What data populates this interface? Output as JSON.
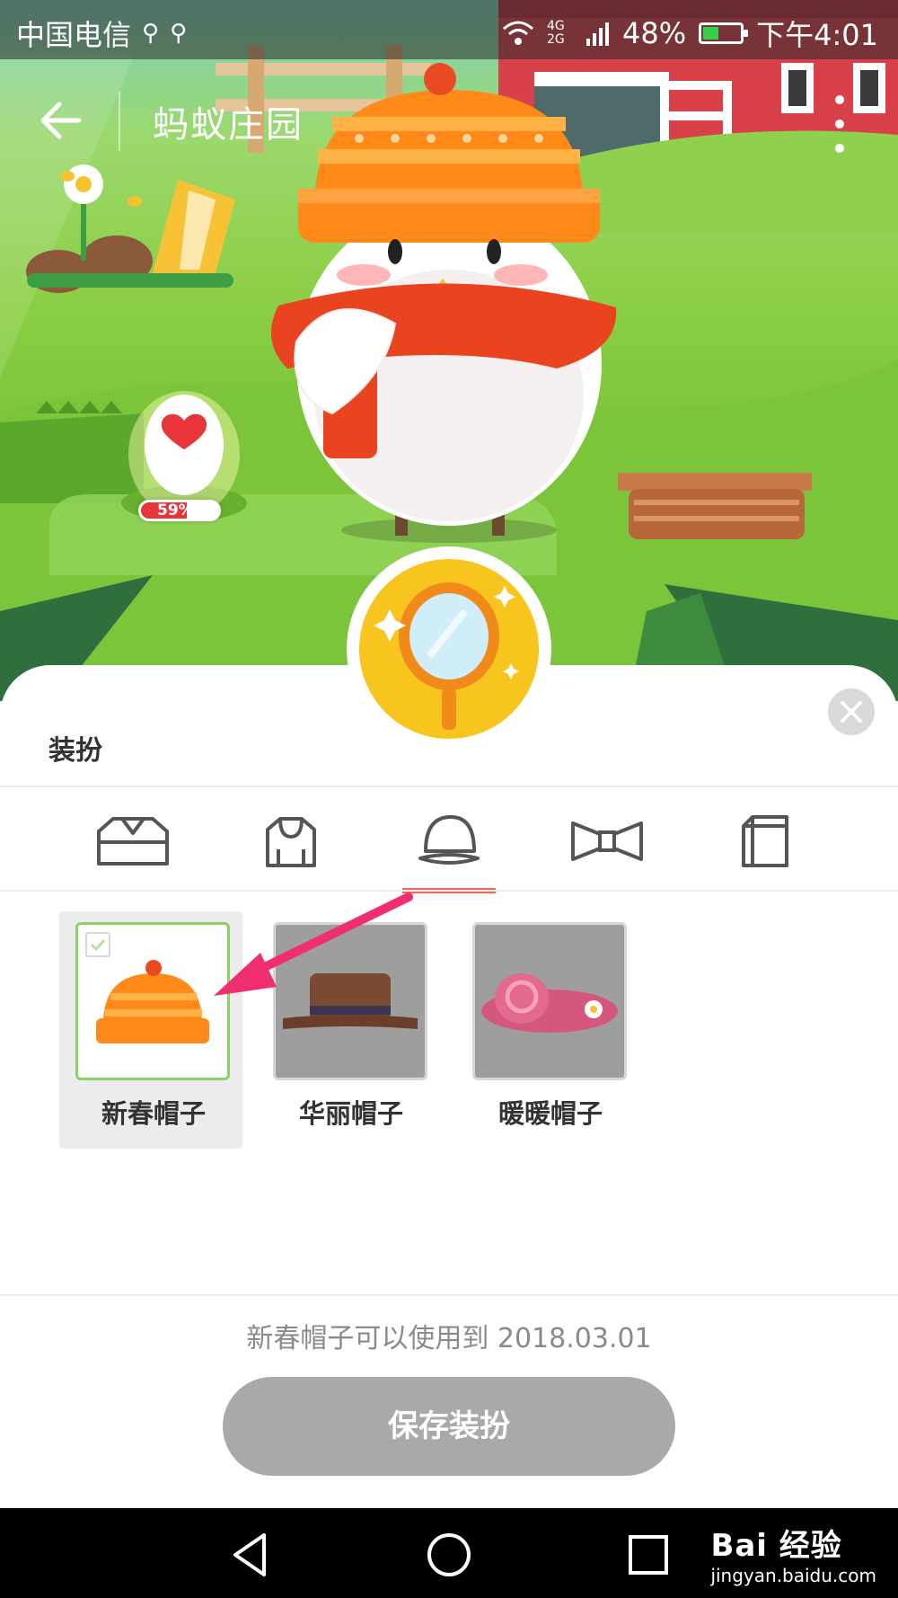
{
  "status_bar": {
    "carrier": "中国电信",
    "network": "4G 2G",
    "battery": "48%",
    "battery_level": 0.48,
    "time": "下午4:01"
  },
  "app_bar": {
    "title": "蚂蚁庄园"
  },
  "scene": {
    "egg_progress_label": "59%",
    "egg_progress": 0.59
  },
  "sheet": {
    "title": "装扮",
    "tabs": [
      {
        "id": "shirt",
        "icon": "shirt-icon"
      },
      {
        "id": "hoodie",
        "icon": "hoodie-icon"
      },
      {
        "id": "hat",
        "icon": "cap-icon",
        "active": true
      },
      {
        "id": "bowtie",
        "icon": "bowtie-icon"
      },
      {
        "id": "bag",
        "icon": "bag-icon"
      }
    ],
    "items": [
      {
        "name": "新春帽子",
        "selected": true
      },
      {
        "name": "华丽帽子",
        "selected": false
      },
      {
        "name": "暖暖帽子",
        "selected": false
      }
    ],
    "usage_note": "新春帽子可以使用到 2018.03.01",
    "save_label": "保存装扮"
  },
  "watermark": {
    "line1": "Bai 经验",
    "line2": "jingyan.baidu.com"
  },
  "colors": {
    "accent": "#f06a5f",
    "selected_border": "#8bd164",
    "save_button": "#a9a9a9",
    "arrow": "#f0306e"
  }
}
